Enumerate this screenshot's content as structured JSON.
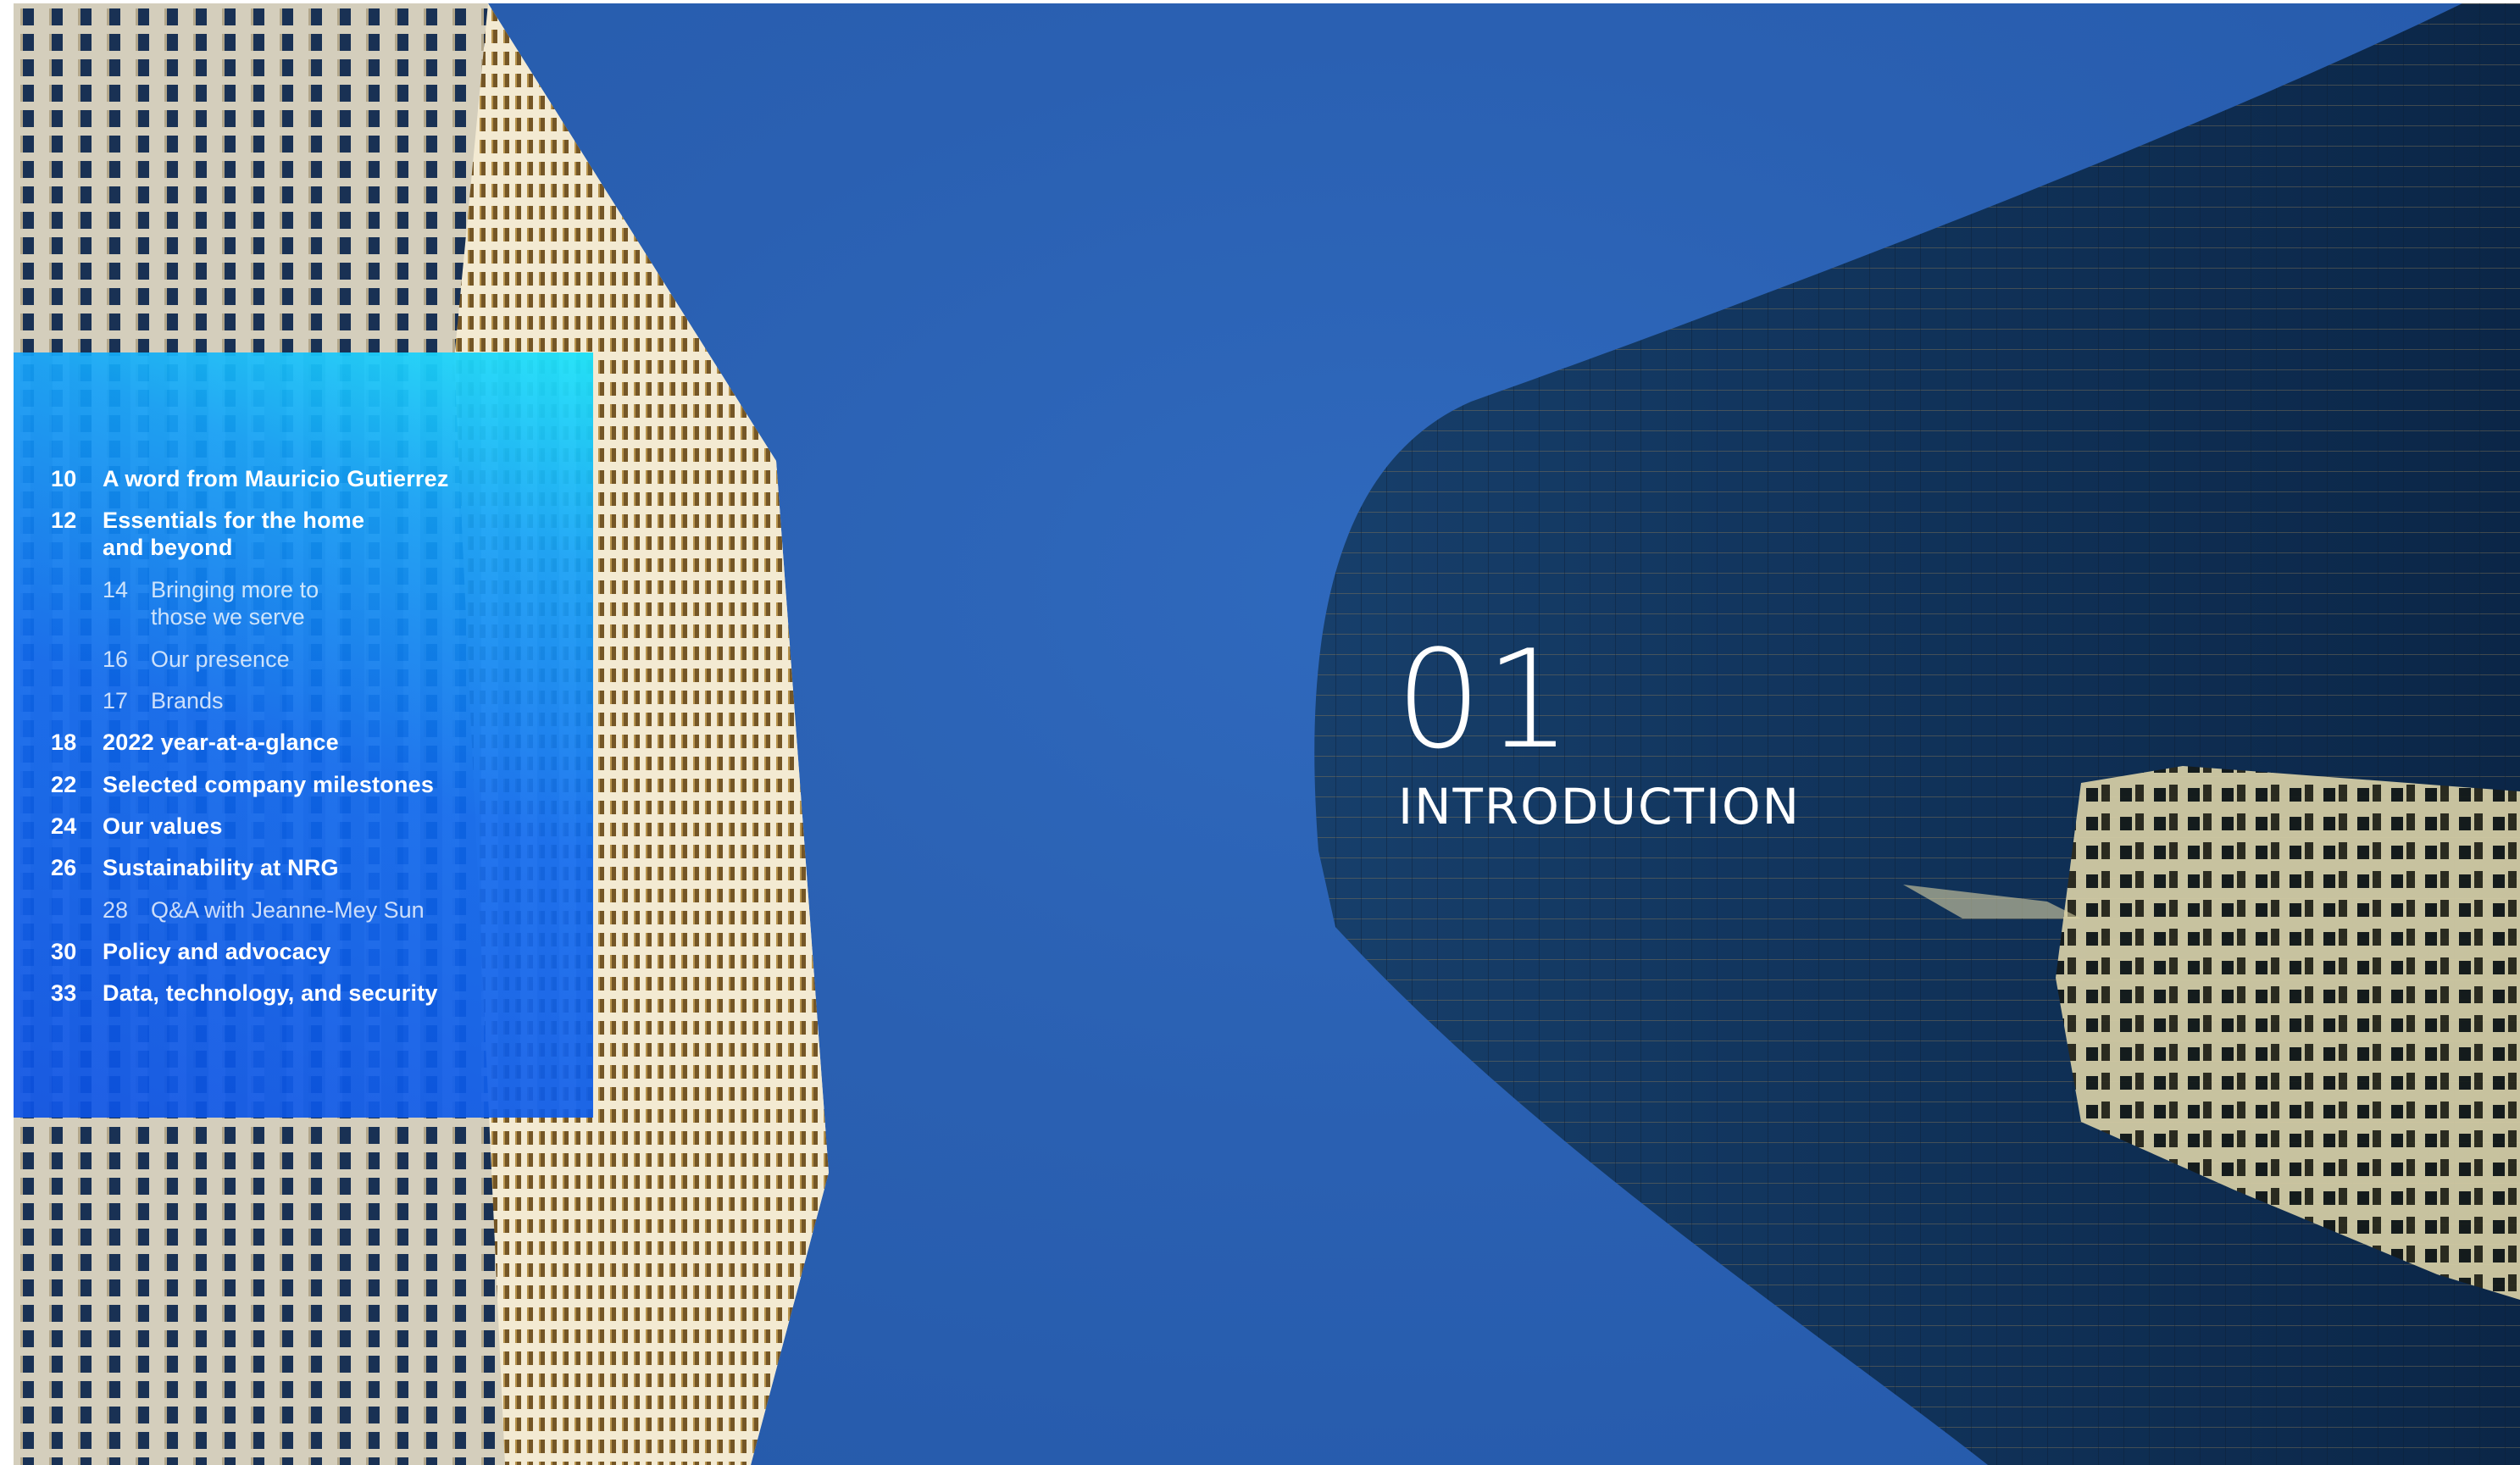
{
  "colors": {
    "sky": "#2b62b4",
    "panel_top": "#1ee4fa",
    "panel_bottom": "#0c52e6",
    "text": "#ffffff"
  },
  "background_photo": {
    "subject": "Two skyscrapers seen from below against a clear blue sky"
  },
  "toc": {
    "items": [
      {
        "num": "10",
        "title": "A word from Mauricio Gutierrez",
        "level": "main"
      },
      {
        "num": "12",
        "title": "Essentials for the home\nand beyond",
        "level": "main"
      },
      {
        "num": "14",
        "title": "Bringing more to\nthose we serve",
        "level": "sub"
      },
      {
        "num": "16",
        "title": "Our presence",
        "level": "sub"
      },
      {
        "num": "17",
        "title": "Brands",
        "level": "sub"
      },
      {
        "num": "18",
        "title": "2022 year-at-a-glance",
        "level": "main"
      },
      {
        "num": "22",
        "title": "Selected company milestones",
        "level": "main"
      },
      {
        "num": "24",
        "title": "Our values",
        "level": "main"
      },
      {
        "num": "26",
        "title": "Sustainability at NRG",
        "level": "main"
      },
      {
        "num": "28",
        "title": "Q&A with Jeanne-Mey Sun",
        "level": "sub"
      },
      {
        "num": "30",
        "title": "Policy and advocacy",
        "level": "main"
      },
      {
        "num": "33",
        "title": "Data, technology, and security",
        "level": "main"
      }
    ]
  },
  "chapter": {
    "number": "01",
    "title": "INTRODUCTION"
  }
}
